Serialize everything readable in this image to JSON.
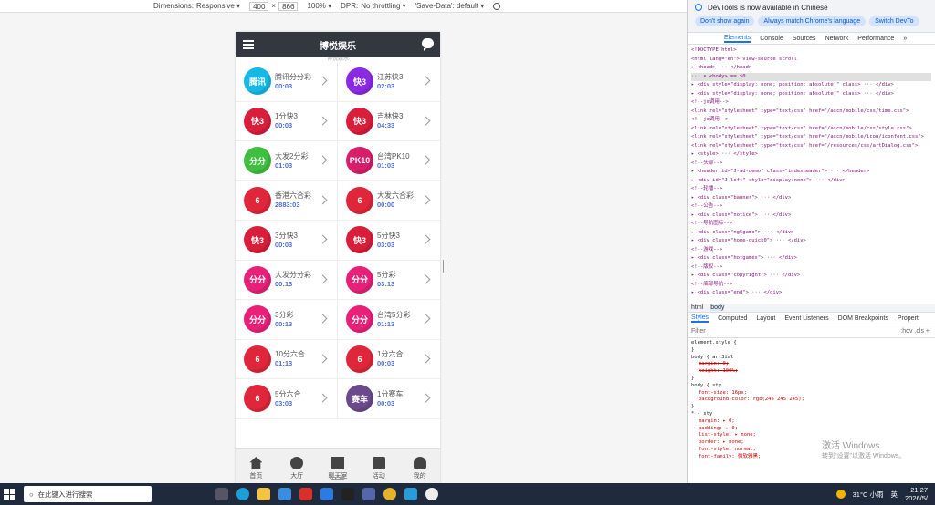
{
  "devtoolbar": {
    "dimensions_label": "Dimensions:",
    "dimensions_value": "Responsive ▾",
    "width": "400",
    "times": "×",
    "height": "866",
    "zoom": "100% ▾",
    "dpr_label": "DPR:",
    "dpr_value": "No throttling ▾",
    "save_data": "'Save-Data': default ▾"
  },
  "app": {
    "title": "博悦娱乐",
    "subtitle": "博悦娱乐",
    "games": [
      {
        "name": "腾讯分分彩",
        "time": "00:03",
        "color": "#16b8e6",
        "badge": "腾讯"
      },
      {
        "name": "江苏快3",
        "time": "02:03",
        "color": "#8a2be2",
        "badge": "快3"
      },
      {
        "name": "1分快3",
        "time": "00:03",
        "color": "#d81e3a",
        "badge": "快3"
      },
      {
        "name": "吉林快3",
        "time": "04:33",
        "color": "#d81e3a",
        "badge": "快3"
      },
      {
        "name": "大发2分彩",
        "time": "01:03",
        "color": "#3fbf3f",
        "badge": "分分"
      },
      {
        "name": "台湾PK10",
        "time": "01:03",
        "color": "#d81e6a",
        "badge": "PK10"
      },
      {
        "name": "香港六合彩",
        "time": "2883:03",
        "color": "#e0263a",
        "badge": "6"
      },
      {
        "name": "大发六合彩",
        "time": "00:00",
        "color": "#e0263a",
        "badge": "6"
      },
      {
        "name": "3分快3",
        "time": "00:03",
        "color": "#d81e3a",
        "badge": "快3"
      },
      {
        "name": "5分快3",
        "time": "03:03",
        "color": "#d81e3a",
        "badge": "快3"
      },
      {
        "name": "大发分分彩",
        "time": "00:13",
        "color": "#e8207a",
        "badge": "分分"
      },
      {
        "name": "5分彩",
        "time": "03:13",
        "color": "#e8207a",
        "badge": "分分"
      },
      {
        "name": "3分彩",
        "time": "00:13",
        "color": "#e8207a",
        "badge": "分分"
      },
      {
        "name": "台湾5分彩",
        "time": "01:13",
        "color": "#e8207a",
        "badge": "分分"
      },
      {
        "name": "10分六合",
        "time": "01:13",
        "color": "#e0263a",
        "badge": "6"
      },
      {
        "name": "1分六合",
        "time": "00:03",
        "color": "#e0263a",
        "badge": "6"
      },
      {
        "name": "5分六合",
        "time": "03:03",
        "color": "#e0263a",
        "badge": "6"
      },
      {
        "name": "1分赛车",
        "time": "00:03",
        "color": "#6a4a8a",
        "badge": "赛车"
      }
    ],
    "tabs": [
      {
        "label": "首页",
        "icon": "home-icon"
      },
      {
        "label": "大厅",
        "icon": "hall-icon"
      },
      {
        "label": "聊天室",
        "icon": "chat-room-icon"
      },
      {
        "label": "活动",
        "icon": "gift-icon"
      },
      {
        "label": "我的",
        "icon": "user-icon"
      }
    ]
  },
  "devtools": {
    "notice": "DevTools is now available in Chinese",
    "btn_dont_show": "Don't show again",
    "btn_match": "Always match Chrome's language",
    "btn_switch": "Switch DevTo",
    "tabs": [
      "Elements",
      "Console",
      "Sources",
      "Network",
      "Performance",
      "»"
    ],
    "code_lines": [
      "<!DOCTYPE html>",
      "<html lang=\"en\"> view-source scroll",
      "▸ <head> ··· </head>",
      "··· ▾ <body> == $0",
      "  ▸ <div style=\"display: none; position: absolute;\" class> ··· </div>",
      "  ▸ <div style=\"display: none; position: absolute;\" class> ··· </div>",
      "    <!--js调用-->",
      "    <link rel=\"stylesheet\" type=\"text/css\" href=\"/ascn/mobile/css/time.css\">",
      "    <!--js调用-->",
      "    <link rel=\"stylesheet\" type=\"text/css\" href=\"/ascn/mobile/css/style.css\">",
      "    <link rel=\"stylesheet\" type=\"text/css\" href=\"/ascn/mobile/icon/iconfont.css\">",
      "    <link rel=\"stylesheet\" type=\"text/css\" href=\"/resources/css/artDialog.css\">",
      "  ▸ <style> ··· </style>",
      "    <!--头部-->",
      "  ▸ <header id=\"J-ad-demo\" class=\"indexheader\"> ··· </header>",
      "  ▸ <div id=\"J-left\" style=\"display:none\"> ··· </div>",
      "    <!--轮播-->",
      "  ▸ <div class=\"banner\"> ··· </div>",
      "    <!--公告-->",
      "  ▸ <div class=\"notice\"> ··· </div>",
      "    <!--导航图标-->",
      "  ▸ <div class=\"ng5game\"> ··· </div>",
      "  ▸ <div class=\"home-quick0\"> ··· </div>",
      "    <!--游戏-->",
      "  ▸ <div class=\"hotgames\"> ··· </div>",
      "    <!--版权-->",
      "  ▸ <div class=\"copyright\"> ··· </div>",
      "    <!--底部导航-->",
      "  ▸ <div class=\"end\"> ··· </div>"
    ],
    "crumb_html": "html",
    "crumb_body": "body",
    "style_tabs": [
      "Styles",
      "Computed",
      "Layout",
      "Event Listeners",
      "DOM Breakpoints",
      "Properti"
    ],
    "filter": "Filter",
    "filter_right": ":hov .cls +",
    "style_lines": [
      "element.style {",
      "}",
      "body {                                       art3ial",
      "  margin: 0;",
      "  height: 100%;",
      "}",
      "body {                                          sty",
      "  font-size: 16px;",
      "  background-color: rgb(245 245 245);",
      "}",
      "* {                                             sty",
      "  margin: ▸ 0;",
      "  padding: ▸ 0;",
      "  list-style: ▸ none;",
      "  border: ▸ none;",
      "  font-style: normal;",
      "  font-family: 微软雅黑;"
    ]
  },
  "watermark": {
    "title": "激活 Windows",
    "sub": "转到\"设置\"以激活 Windows。"
  },
  "taskbar": {
    "search": "在此键入进行搜索",
    "weather": "31°C 小雨",
    "ime": "英",
    "time": "21:27",
    "date": "2026/5/"
  }
}
